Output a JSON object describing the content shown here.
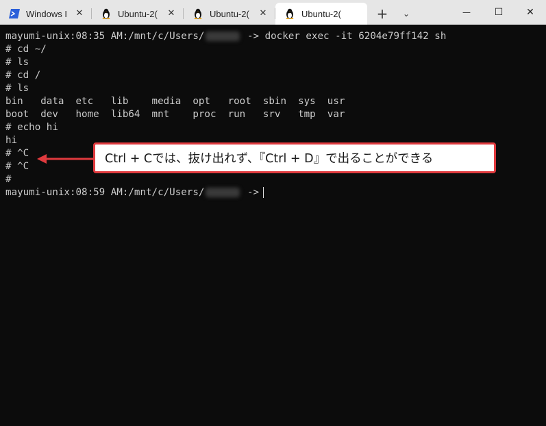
{
  "tabs": [
    {
      "title": "Windows I",
      "icon": "powershell-icon",
      "active": false
    },
    {
      "title": "Ubuntu-2(",
      "icon": "linux-tux-icon",
      "active": false
    },
    {
      "title": "Ubuntu-2(",
      "icon": "linux-tux-icon",
      "active": false
    },
    {
      "title": "Ubuntu-2(",
      "icon": "linux-tux-icon",
      "active": true
    }
  ],
  "tab_close_glyph": "✕",
  "newtab_glyph": "+",
  "dropdown_glyph": "⌄",
  "window_controls": {
    "minimize": "—",
    "maximize": "☐",
    "close": "✕"
  },
  "terminal": {
    "prompt1_prefix": "mayumi-unix:08:35 AM:/mnt/c/Users/",
    "prompt1_suffix": " -> docker exec -it 6204e79ff142 sh",
    "lines": [
      "# cd ~/",
      "# ls",
      "# cd /",
      "# ls",
      "bin   data  etc   lib    media  opt   root  sbin  sys  usr",
      "boot  dev   home  lib64  mnt    proc  run   srv   tmp  var",
      "# echo hi",
      "hi",
      "# ^C",
      "# ^C",
      "#"
    ],
    "prompt2_prefix": "mayumi-unix:08:59 AM:/mnt/c/Users/",
    "prompt2_suffix": " ->"
  },
  "annotation": {
    "text": "Ctrl + Cでは、抜け出れず、『Ctrl + D』で出ることができる",
    "color": "#e03a3e"
  }
}
